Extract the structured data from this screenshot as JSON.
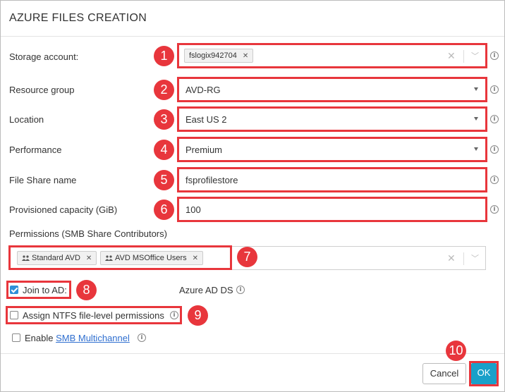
{
  "dialog": {
    "title": "AZURE FILES CREATION"
  },
  "fields": {
    "storage_account": {
      "label": "Storage account:",
      "tag": "fslogix942704"
    },
    "resource_group": {
      "label": "Resource group",
      "value": "AVD-RG"
    },
    "location": {
      "label": "Location",
      "value": "East US 2"
    },
    "performance": {
      "label": "Performance",
      "value": "Premium"
    },
    "file_share_name": {
      "label": "File Share name",
      "value": "fsprofilestore"
    },
    "provisioned_capacity": {
      "label": "Provisioned capacity (GiB)",
      "value": "100"
    },
    "permissions": {
      "label": "Permissions (SMB Share Contributors)",
      "tags": [
        "Standard AVD",
        "AVD MSOffice Users"
      ]
    }
  },
  "options": {
    "join_ad": {
      "label": "Join to AD:",
      "checked": true
    },
    "azure_ad_ds": "Azure AD DS",
    "ntfs": {
      "label": "Assign NTFS file-level permissions",
      "checked": false
    },
    "smb": {
      "prefix": "Enable ",
      "link": "SMB Multichannel",
      "checked": false
    }
  },
  "callouts": [
    "1",
    "2",
    "3",
    "4",
    "5",
    "6",
    "7",
    "8",
    "9",
    "10"
  ],
  "buttons": {
    "cancel": "Cancel",
    "ok": "OK"
  },
  "colors": {
    "highlight": "#e8363c",
    "primary": "#19a0c9",
    "checkbox": "#2f8fd8"
  },
  "icons": {
    "remove": "×",
    "clear": "×",
    "dropdown": "chevron-down",
    "info": "i",
    "group": "people"
  }
}
